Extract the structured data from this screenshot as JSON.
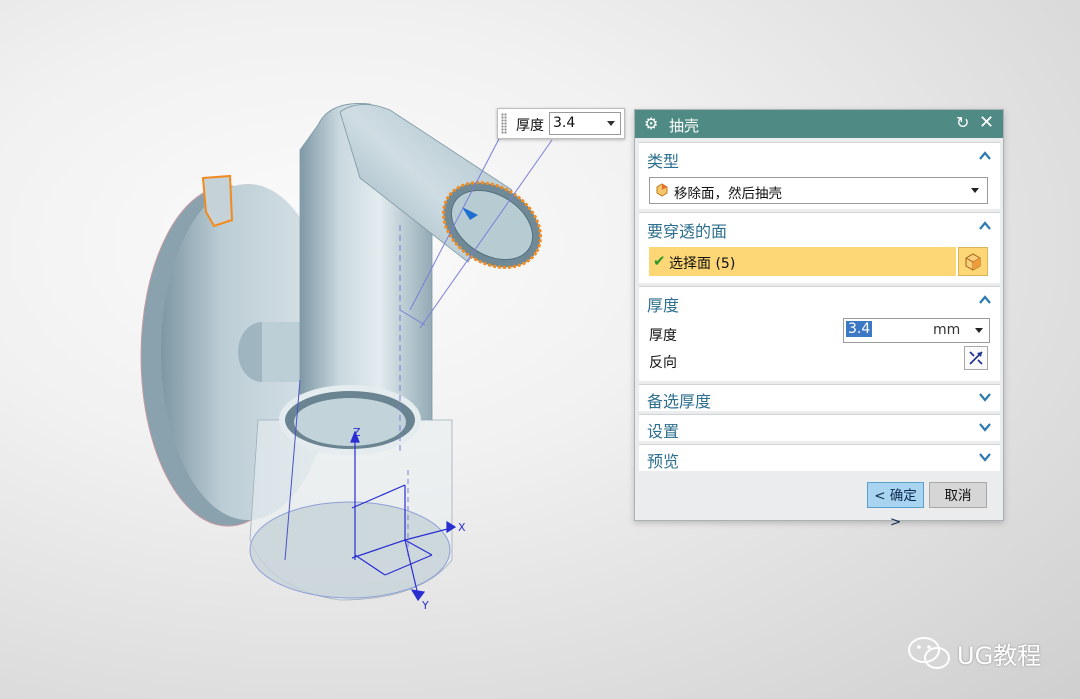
{
  "floating_field": {
    "label": "厚度",
    "value": "3.4"
  },
  "dialog": {
    "title": "抽壳",
    "sections": {
      "type": {
        "title": "类型",
        "selected": "移除面，然后抽壳"
      },
      "faces": {
        "title": "要穿透的面",
        "selection_label": "选择面 (5)"
      },
      "thickness": {
        "title": "厚度",
        "label": "厚度",
        "value": "3.4",
        "unit": "mm",
        "reverse_label": "反向"
      },
      "alt_thickness": {
        "title": "备选厚度"
      },
      "settings": {
        "title": "设置"
      },
      "preview": {
        "title": "预览"
      }
    },
    "ok_label": "< 确定 >",
    "cancel_label": "取消"
  },
  "axes": {
    "x": "X",
    "y": "Y",
    "z": "Z"
  },
  "watermark": {
    "text": "UG教程"
  },
  "colors": {
    "titlebar": "#4f8a85",
    "section_title": "#2d6f8e",
    "selection_highlight": "#fdd675",
    "model": "#a9c3cf",
    "edge_highlight": "#f28a1e"
  }
}
